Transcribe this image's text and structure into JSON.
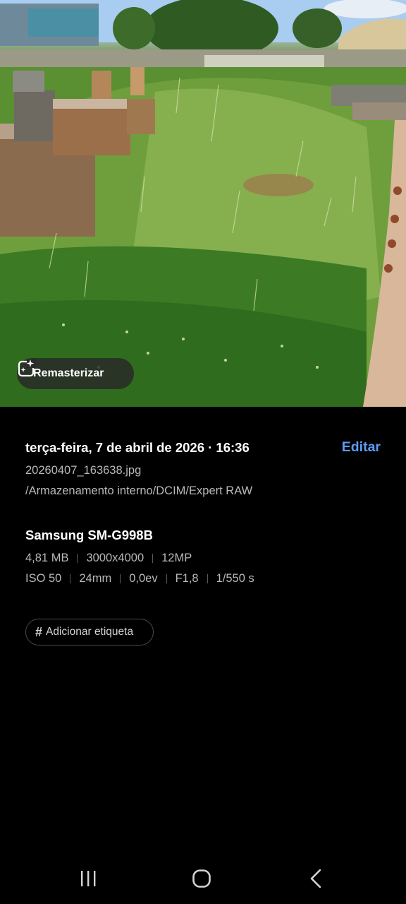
{
  "photo": {
    "remaster_label": "Remasterizar",
    "remaster_icon": "sparkle-frame-icon"
  },
  "details": {
    "datetime": "terça-feira, 7 de abril de 2026 · 16:36",
    "edit_label": "Editar",
    "file_name": "20260407_163638.jpg",
    "file_path": "/Armazenamento interno/DCIM/Expert RAW",
    "device": "Samsung SM-G998B",
    "specs_row1": [
      "4,81 MB",
      "3000x4000",
      "12MP"
    ],
    "specs_row2": [
      "ISO 50",
      "24mm",
      "0,0ev",
      "F1,8",
      "1/550 s"
    ],
    "tag_label": "Adicionar etiqueta"
  },
  "colors": {
    "background": "#000000",
    "accent": "#5b9bf5",
    "secondary_text": "#b9b9b9"
  },
  "navbar": {
    "icons": [
      "recent-apps-icon",
      "home-icon",
      "back-icon"
    ]
  }
}
